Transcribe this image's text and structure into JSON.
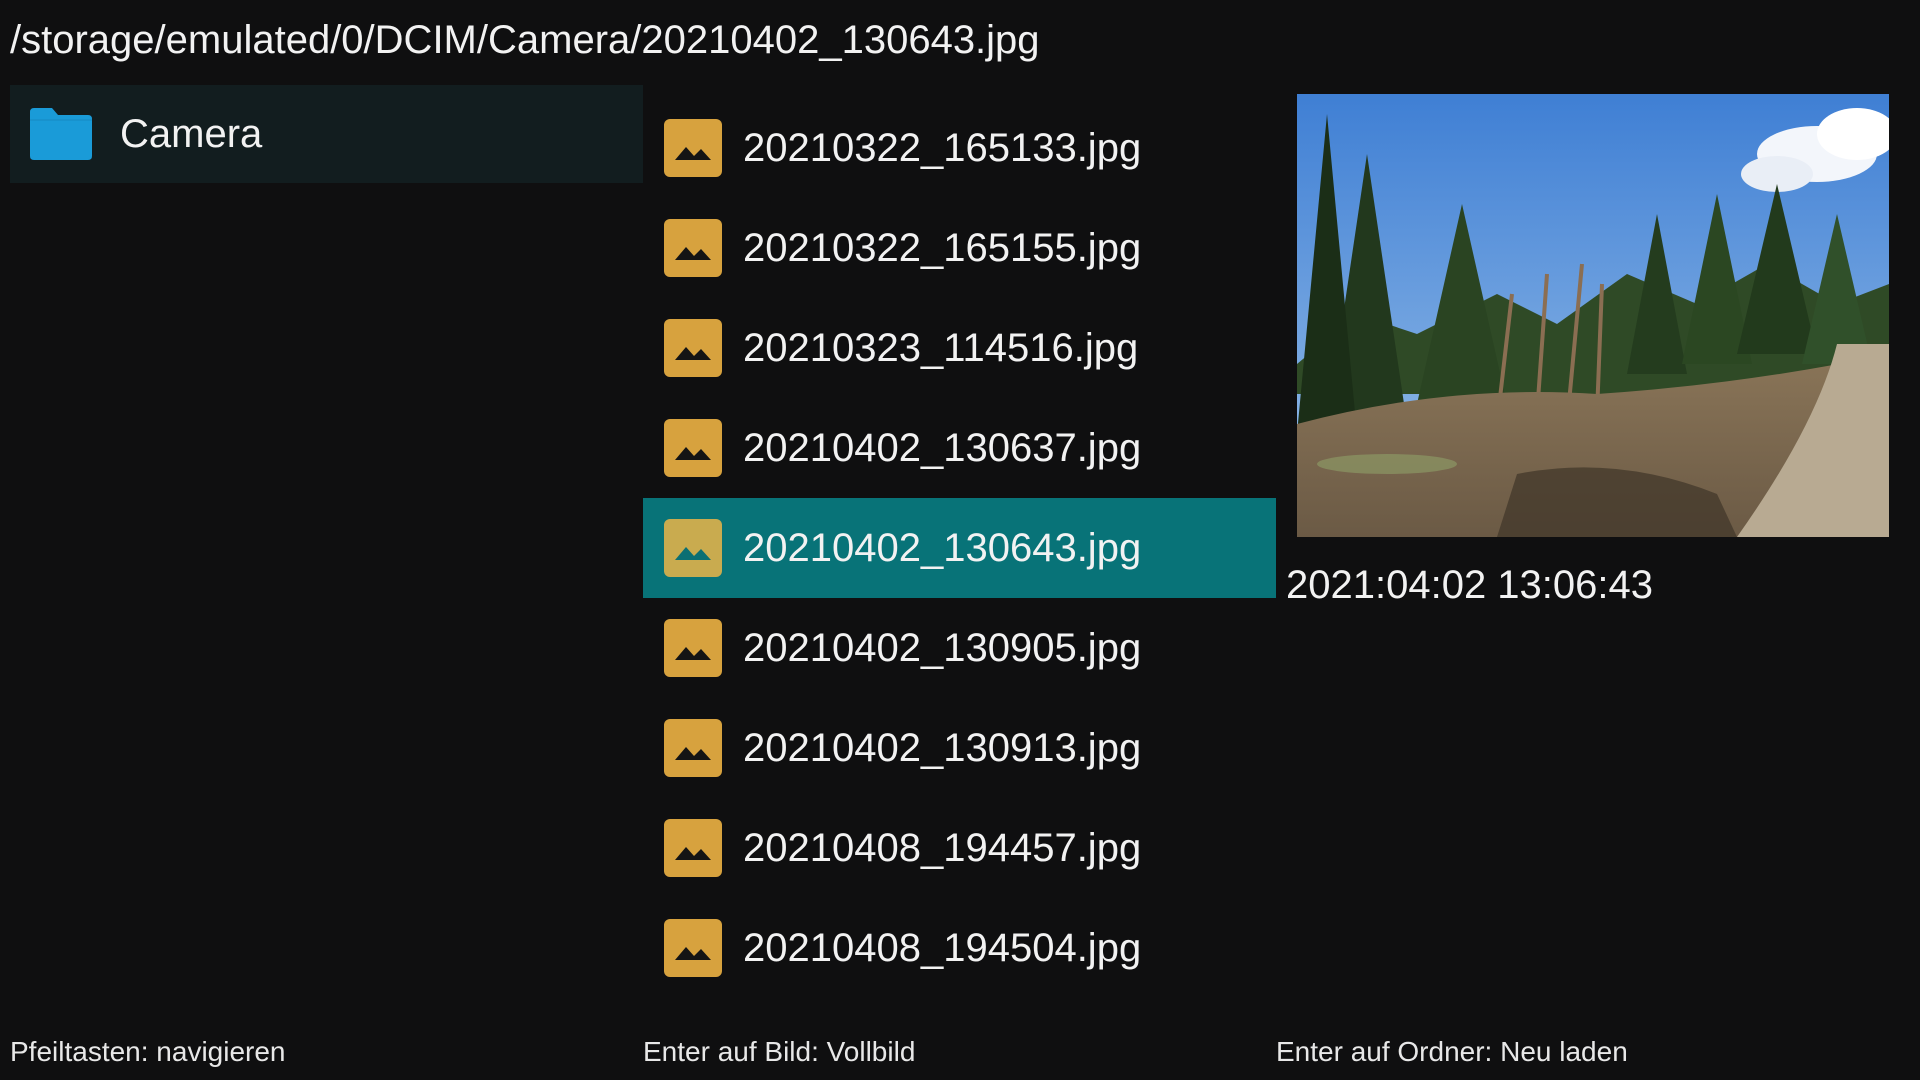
{
  "path": "/storage/emulated/0/DCIM/Camera/20210402_130643.jpg",
  "folders": [
    {
      "label": "Camera",
      "icon": "folder-icon",
      "color": "#1a9bd8"
    }
  ],
  "files": [
    {
      "label": "20210322_165133.jpg",
      "icon": "image-icon"
    },
    {
      "label": "20210322_165155.jpg",
      "icon": "image-icon"
    },
    {
      "label": "20210323_114516.jpg",
      "icon": "image-icon"
    },
    {
      "label": "20210402_130637.jpg",
      "icon": "image-icon"
    },
    {
      "label": "20210402_130643.jpg",
      "icon": "image-icon",
      "selected": true
    },
    {
      "label": "20210402_130905.jpg",
      "icon": "image-icon"
    },
    {
      "label": "20210402_130913.jpg",
      "icon": "image-icon"
    },
    {
      "label": "20210408_194457.jpg",
      "icon": "image-icon"
    },
    {
      "label": "20210408_194504.jpg",
      "icon": "image-icon"
    }
  ],
  "preview": {
    "date": "2021:04:02 13:06:43"
  },
  "footer": {
    "hint_navigate": "Pfeiltasten: navigieren",
    "hint_image": "Enter auf Bild: Vollbild",
    "hint_folder": "Enter auf Ordner: Neu laden"
  },
  "colors": {
    "background": "#0f0f10",
    "selection": "#087378",
    "folder_row": "#121d1f",
    "image_icon": "#d7a23e",
    "folder_icon": "#1a9bd8"
  }
}
